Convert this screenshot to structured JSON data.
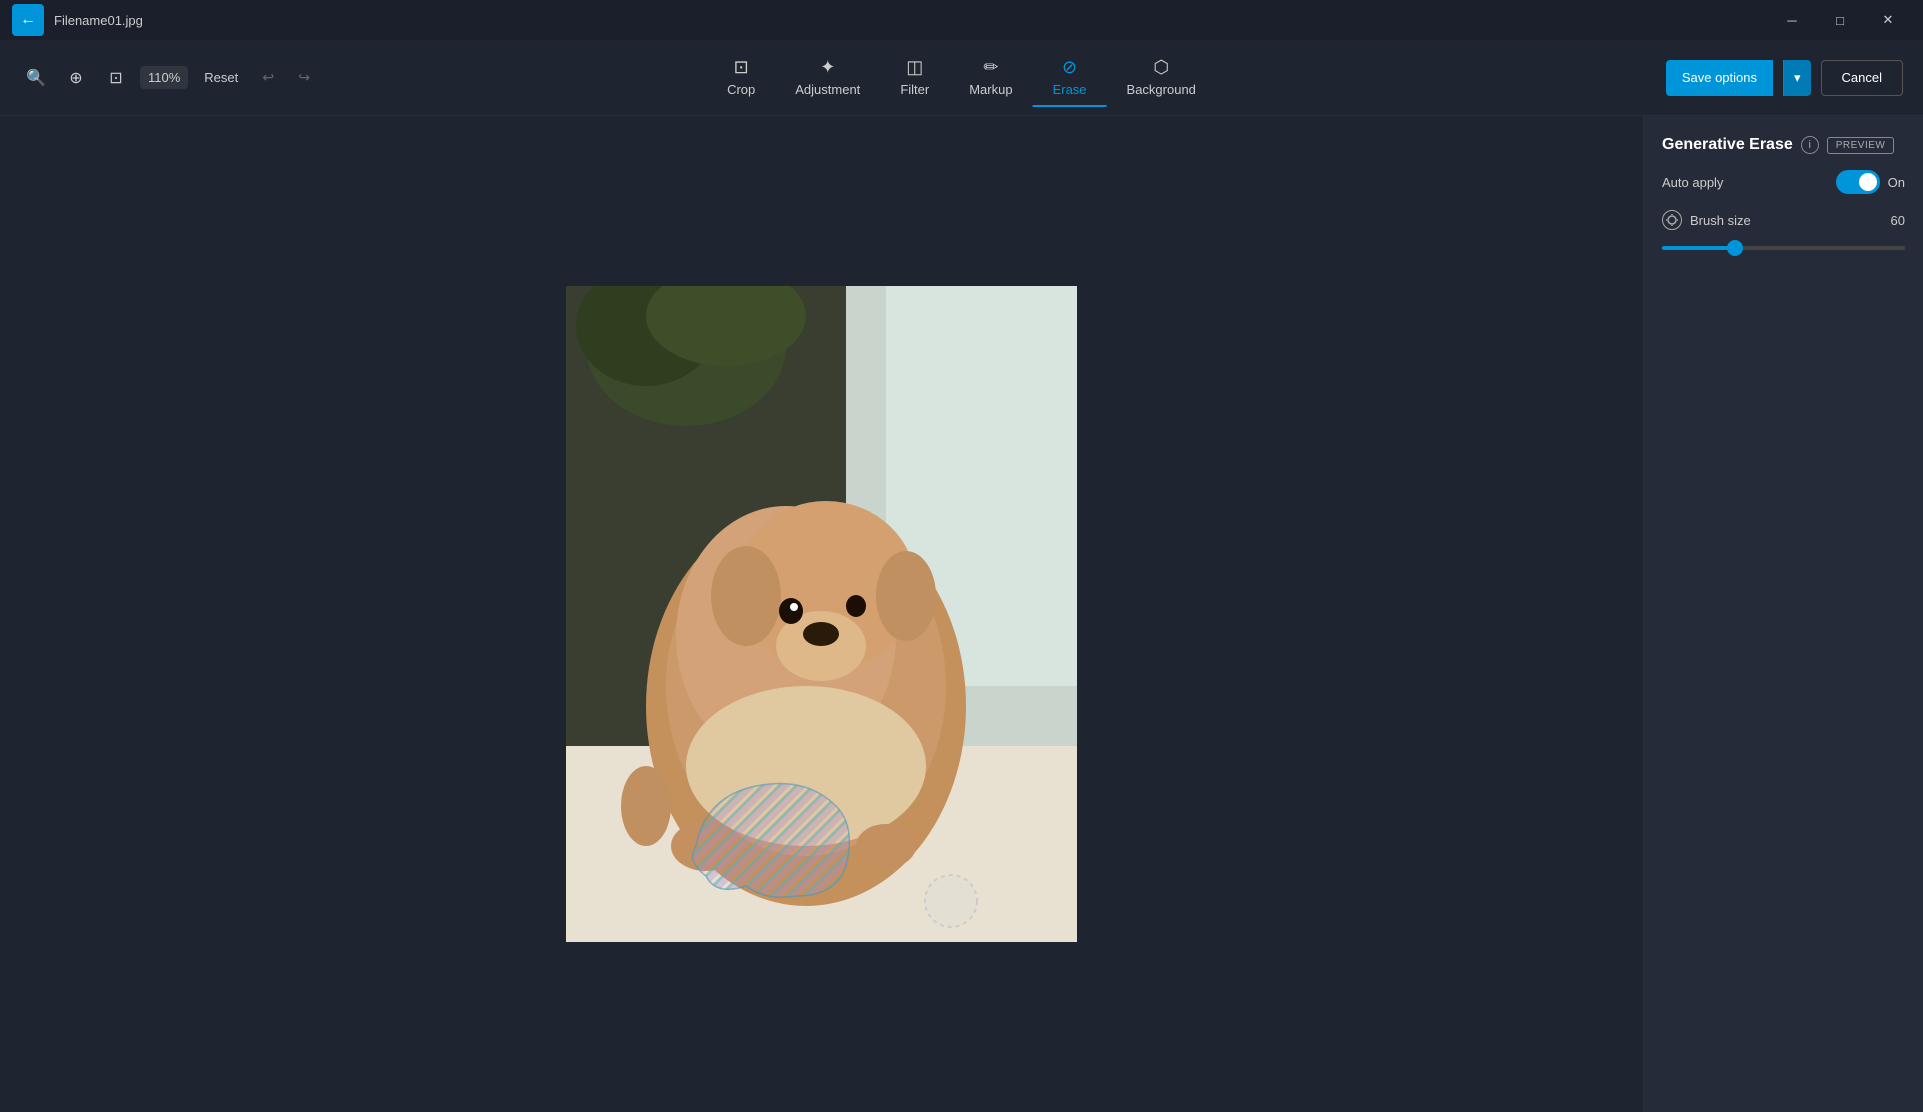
{
  "titlebar": {
    "filename": "Filename01.jpg",
    "back_icon": "←",
    "minimize_icon": "─",
    "restore_icon": "□",
    "close_icon": "✕"
  },
  "toolbar": {
    "zoom_level": "110%",
    "reset_label": "Reset",
    "undo_icon": "↩",
    "redo_icon": "↪",
    "tools": [
      {
        "id": "crop",
        "label": "Crop",
        "icon": "⊞"
      },
      {
        "id": "adjustment",
        "label": "Adjustment",
        "icon": "☀"
      },
      {
        "id": "filter",
        "label": "Filter",
        "icon": "▦"
      },
      {
        "id": "markup",
        "label": "Markup",
        "icon": "✎"
      },
      {
        "id": "erase",
        "label": "Erase",
        "icon": "◎"
      },
      {
        "id": "background",
        "label": "Background",
        "icon": "⬡"
      }
    ],
    "save_options_label": "Save options",
    "cancel_label": "Cancel",
    "dropdown_icon": "▾"
  },
  "panel": {
    "title": "Generative Erase",
    "info_icon": "i",
    "preview_label": "PREVIEW",
    "auto_apply_label": "Auto apply",
    "toggle_state": "On",
    "brush_size_label": "Brush size",
    "brush_size_value": "60",
    "slider_percent": 30
  }
}
